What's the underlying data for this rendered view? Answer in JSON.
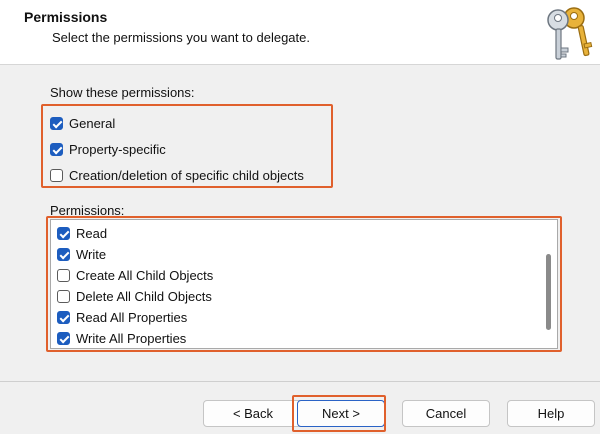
{
  "header": {
    "title": "Permissions",
    "subtitle": "Select the permissions you want to delegate."
  },
  "show_section": {
    "label": "Show these permissions:",
    "options": [
      {
        "label": "General",
        "checked": true
      },
      {
        "label": "Property-specific",
        "checked": true
      },
      {
        "label": "Creation/deletion of specific child objects",
        "checked": false
      }
    ]
  },
  "permissions_section": {
    "label": "Permissions:",
    "items": [
      {
        "label": "Read",
        "checked": true
      },
      {
        "label": "Write",
        "checked": true
      },
      {
        "label": "Create All Child Objects",
        "checked": false
      },
      {
        "label": "Delete All Child Objects",
        "checked": false
      },
      {
        "label": "Read All Properties",
        "checked": true
      },
      {
        "label": "Write All Properties",
        "checked": true
      }
    ]
  },
  "buttons": {
    "back": "< Back",
    "next": "Next >",
    "cancel": "Cancel",
    "help": "Help"
  },
  "colors": {
    "accent_checkbox": "#1d5dbf",
    "highlight_border": "#e0602c"
  },
  "icons": {
    "header": "keys-icon"
  }
}
